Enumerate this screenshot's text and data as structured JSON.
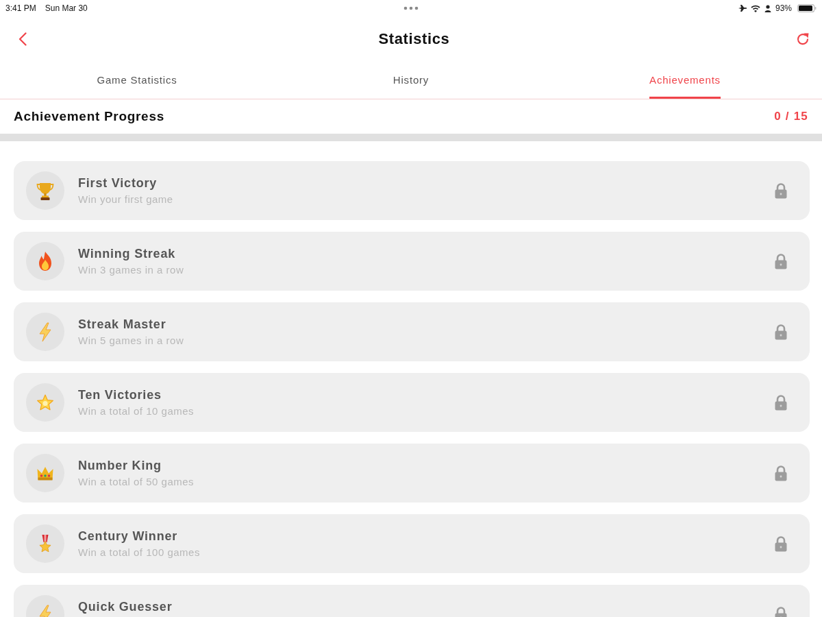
{
  "status_bar": {
    "time": "3:41 PM",
    "date": "Sun Mar 30",
    "battery_percent": "93%"
  },
  "nav": {
    "title": "Statistics"
  },
  "tabs": [
    {
      "label": "Game Statistics",
      "selected": false
    },
    {
      "label": "History",
      "selected": false
    },
    {
      "label": "Achievements",
      "selected": true
    }
  ],
  "progress": {
    "title": "Achievement Progress",
    "count": "0 / 15",
    "level": 0
  },
  "achievements": [
    {
      "title": "First Victory",
      "description": "Win your first game",
      "locked": true
    },
    {
      "title": "Winning Streak",
      "description": "Win 3 games in a row",
      "locked": true
    },
    {
      "title": "Streak Master",
      "description": "Win 5 games in a row",
      "locked": true
    },
    {
      "title": "Ten Victories",
      "description": "Win a total of 10 games",
      "locked": true
    },
    {
      "title": "Number King",
      "description": "Win a total of 50 games",
      "locked": true
    },
    {
      "title": "Century Winner",
      "description": "Win a total of 100 games",
      "locked": true
    },
    {
      "title": "Quick Guesser",
      "locked": true
    }
  ]
}
